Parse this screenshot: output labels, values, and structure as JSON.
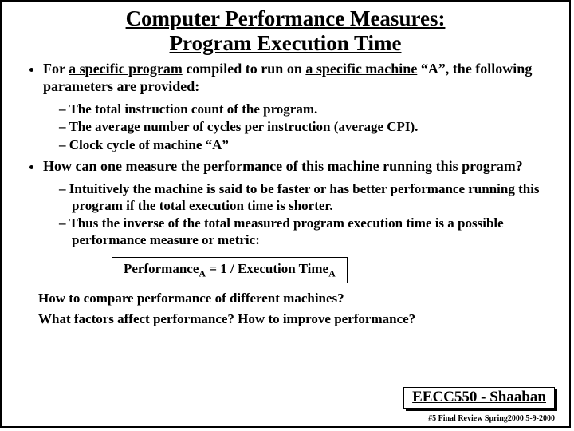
{
  "title_line1": "Computer Performance Measures:",
  "title_line2": "Program Execution Time",
  "bullet1": {
    "pre": "For ",
    "u1": "a specific program",
    "mid": " compiled to run on ",
    "u2": "a specific machine",
    "post": " “A”, the following parameters are provided:"
  },
  "sub1": [
    "The total instruction count of the program.",
    "The average number of cycles per instruction (average CPI).",
    "Clock cycle of machine “A”"
  ],
  "bullet2": "How can one measure the performance of this machine running this program?",
  "sub2": [
    "Intuitively the machine is said to be faster or has better performance running this program if the total execution time is shorter.",
    "Thus the inverse of the total measured program execution time is a possible performance measure or metric:"
  ],
  "formula": {
    "lhs": "Performance",
    "subA": "A",
    "mid": "  =   1  /    Execution Time",
    "subB": "A"
  },
  "closing1": "How to compare performance of different machines?",
  "closing2": "What factors affect performance?  How to improve performance?",
  "course": "EECC550 - Shaaban",
  "footer": "#5   Final Review   Spring2000   5-9-2000"
}
